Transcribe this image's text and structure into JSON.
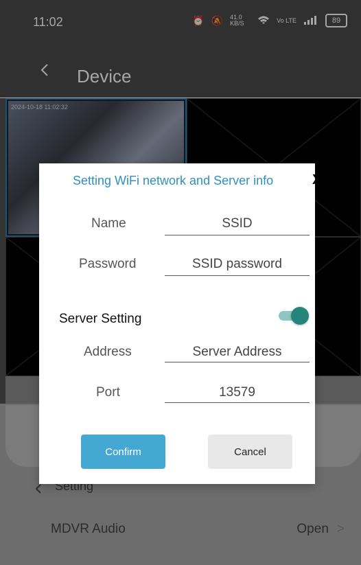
{
  "status": {
    "time": "11:02",
    "speed": "41.0 KB/S",
    "battery": "89"
  },
  "header": {
    "title": "Device"
  },
  "camera": {
    "timestamp": "2024-10-18 11:02:32"
  },
  "background": {
    "setting_label": "Setting",
    "audio_label": "MDVR Audio",
    "audio_value": "Open",
    "audio_chevron": ">"
  },
  "dialog": {
    "title": "Setting WiFi network and Server info",
    "close": "X",
    "fields": {
      "name": {
        "label": "Name",
        "value": "SSID"
      },
      "password": {
        "label": "Password",
        "value": "SSID password"
      },
      "address": {
        "label": "Address",
        "value": "Server Address"
      },
      "port": {
        "label": "Port",
        "value": "13579"
      }
    },
    "server_setting": {
      "label": "Server Setting",
      "enabled": true
    },
    "confirm": "Confirm",
    "cancel": "Cancel"
  },
  "colors": {
    "accent": "#2f8fbf",
    "confirm": "#45a8d2",
    "toggle_on": "#26857a"
  }
}
